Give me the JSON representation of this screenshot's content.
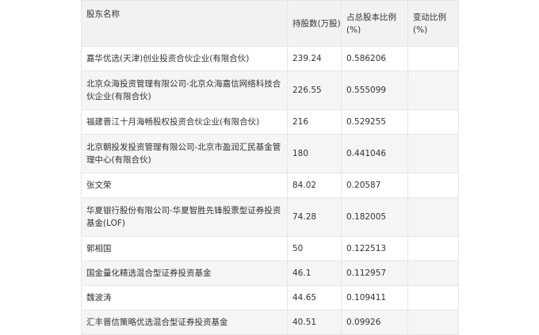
{
  "table": {
    "headers": [
      "股东名称",
      "持股数(万股)",
      "占总股本比例(%)",
      "变动比例(%)"
    ],
    "rows": [
      {
        "name": "嘉华优选(天津)创业投资合伙企业(有限合伙)",
        "shares": "239.24",
        "ratio": "0.586206",
        "change": ""
      },
      {
        "name": "北京众海投资管理有限公司-北京众海嘉信网络科技合伙企业(有限合伙)",
        "shares": "226.55",
        "ratio": "0.555099",
        "change": ""
      },
      {
        "name": "福建晋江十月海畅股权投资合伙企业(有限合伙)",
        "shares": "216",
        "ratio": "0.529255",
        "change": ""
      },
      {
        "name": "北京朝投发投资管理有限公司-北京市盈润汇民基金管理中心(有限合伙)",
        "shares": "180",
        "ratio": "0.441046",
        "change": ""
      },
      {
        "name": "张文荣",
        "shares": "84.02",
        "ratio": "0.20587",
        "change": ""
      },
      {
        "name": "华夏银行股份有限公司-华夏智胜先锋股票型证券投资基金(LOF)",
        "shares": "74.28",
        "ratio": "0.182005",
        "change": ""
      },
      {
        "name": "郭相国",
        "shares": "50",
        "ratio": "0.122513",
        "change": ""
      },
      {
        "name": "国金量化精选混合型证券投资基金",
        "shares": "46.1",
        "ratio": "0.112957",
        "change": ""
      },
      {
        "name": "魏波涛",
        "shares": "44.65",
        "ratio": "0.109411",
        "change": ""
      },
      {
        "name": "汇丰晋信策略优选混合型证券投资基金",
        "shares": "40.51",
        "ratio": "0.09926",
        "change": ""
      }
    ]
  }
}
